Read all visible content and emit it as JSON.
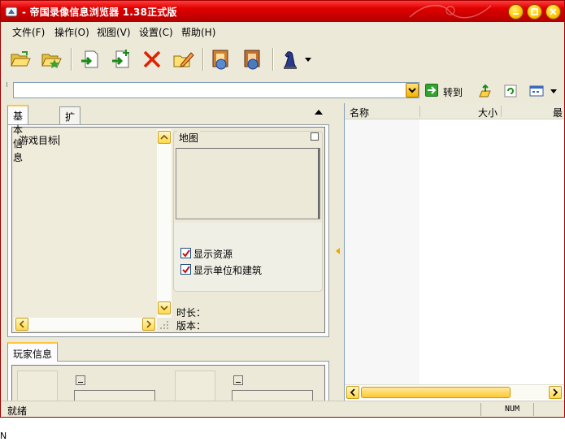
{
  "window": {
    "title": "- 帝国录像信息浏览器 1.38正式版",
    "accent": "#d00000",
    "controls": [
      "minimize-icon",
      "maximize-icon",
      "close-icon"
    ]
  },
  "menu": [
    "文件(F)",
    "操作(O)",
    "视图(V)",
    "设置(C)",
    "帮助(H)"
  ],
  "toolbar": {
    "icons": [
      "open-folder-icon",
      "open-folder-star-icon",
      "import-icon",
      "add-icon",
      "delete-icon",
      "edit-icon",
      "analyze-icon",
      "analyze-alt-icon",
      "knight-icon"
    ]
  },
  "addressbar": {
    "value": "",
    "goto_label": "转到"
  },
  "left": {
    "tabs": [
      "基本信息",
      "扩展信息"
    ],
    "goal_label": "游戏目标",
    "map_label": "地图",
    "checkbox_resources": "显示资源",
    "checkbox_units": "显示单位和建筑",
    "duration_label": "时长：",
    "version_label": "版本：",
    "player_tab": "玩家信息"
  },
  "list": {
    "columns": [
      "名称",
      "大小",
      "最"
    ]
  },
  "status": {
    "text": "就绪",
    "num": "NUM"
  },
  "stray": "N"
}
